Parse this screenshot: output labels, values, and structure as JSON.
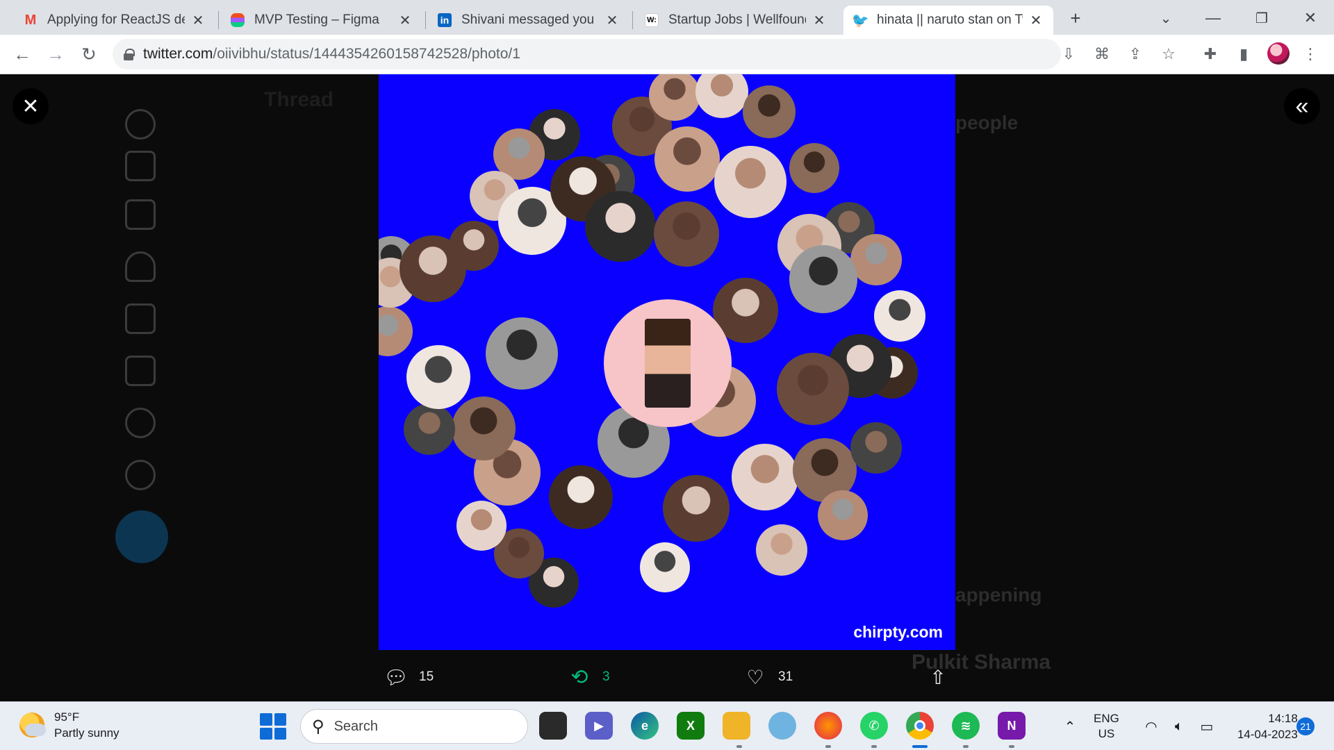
{
  "browser": {
    "tabs": [
      {
        "title": "Applying for ReactJS deve",
        "icon": "gmail-icon",
        "active": false
      },
      {
        "title": "MVP Testing – Figma",
        "icon": "figma-icon",
        "active": false
      },
      {
        "title": "Shivani messaged you",
        "icon": "linkedin-icon",
        "active": false
      },
      {
        "title": "Startup Jobs | Wellfound (",
        "icon": "wellfound-icon",
        "active": false
      },
      {
        "title": "hinata || naruto stan on Tw",
        "icon": "twitter-icon",
        "active": true
      }
    ],
    "url_host": "twitter.com",
    "url_path": "/oiivibhu/status/1444354260158742528/photo/1"
  },
  "page": {
    "background_thread_title": "Thread",
    "background_people_heading": "people",
    "background_happening_heading": "appening",
    "background_pulkit": "Pulkit Sharma",
    "watermark": "chirpty.com",
    "actions": {
      "replies": "15",
      "retweets": "3",
      "likes": "31"
    }
  },
  "taskbar": {
    "weather_temp": "95°F",
    "weather_desc": "Partly sunny",
    "search_placeholder": "Search",
    "lang_top": "ENG",
    "lang_bottom": "US",
    "time": "14:18",
    "date": "14-04-2023",
    "notifications": "21"
  },
  "colors": {
    "photo_background": "#0a00ff",
    "retweet_green": "#00ba7c",
    "center_ring": "#f7c4c8"
  }
}
